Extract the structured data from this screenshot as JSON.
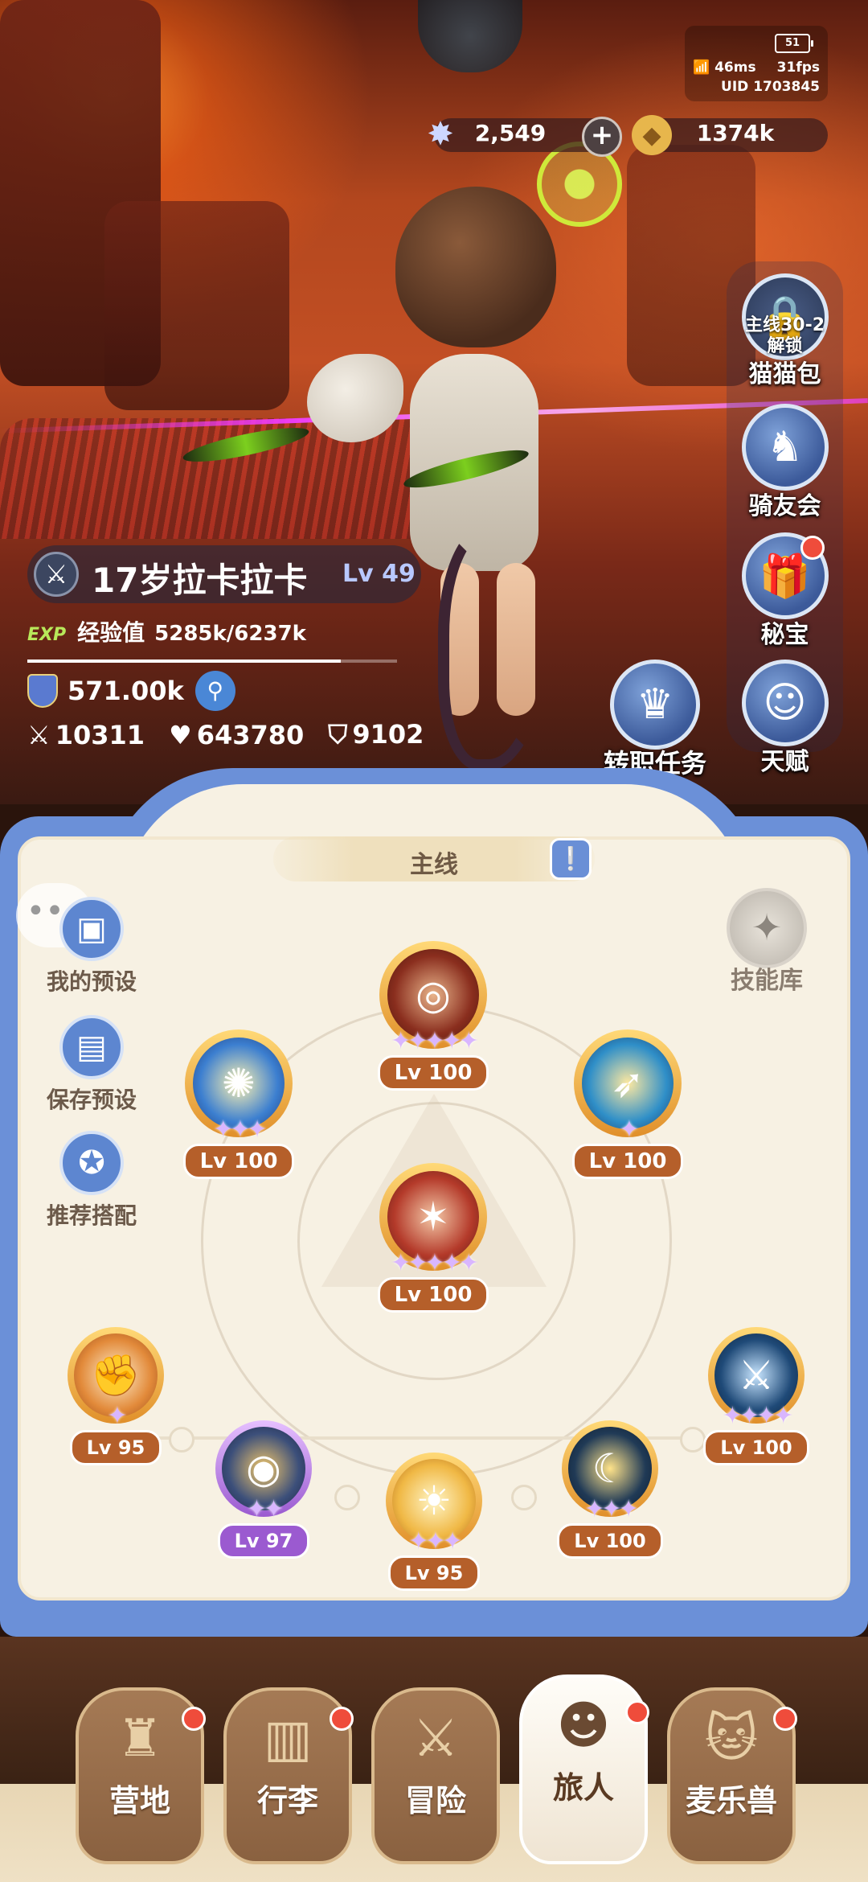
{
  "hud": {
    "battery": "51",
    "ping": "46ms",
    "fps": "31fps",
    "uid": "UID 1703845",
    "gems": "2,549",
    "gold": "1374k"
  },
  "right_menu": [
    {
      "label": "猫猫包",
      "lock_line1": "主线30-2",
      "lock_line2": "解锁",
      "icon": "lock-icon"
    },
    {
      "label": "骑友会",
      "icon": "horse-icon"
    },
    {
      "label": "秘宝",
      "icon": "treasure-chest-icon"
    },
    {
      "label": "天赋",
      "icon": "brain-icon"
    }
  ],
  "job_quest": {
    "label": "转职任务",
    "icon": "crown-icon"
  },
  "player": {
    "name": "17岁拉卡拉卡",
    "level": "Lv 49",
    "exp_badge": "EXP",
    "exp_label": "经验值",
    "exp_value": "5285k/6237k",
    "exp_progress": 0.847,
    "power": "571.00k",
    "attack": "10311",
    "hp": "643780",
    "defense": "9102"
  },
  "panel": {
    "tab": "主线",
    "left_buttons": [
      {
        "label": "我的预设",
        "icon": "preset-icon"
      },
      {
        "label": "保存预设",
        "icon": "save-icon"
      },
      {
        "label": "推荐搭配",
        "icon": "recommend-icon"
      }
    ],
    "skill_library": "技能库"
  },
  "skills": {
    "top": {
      "level": "Lv 100",
      "stars": "✦✦✦✦✦"
    },
    "upper_left": {
      "level": "Lv 100",
      "stars": "✦✦✦"
    },
    "upper_right": {
      "level": "Lv 100",
      "stars": "✦"
    },
    "center": {
      "level": "Lv 100",
      "stars": "✦✦✦✦✦"
    },
    "bottom1": {
      "level": "Lv 95",
      "stars": "✦"
    },
    "bottom2": {
      "level": "Lv 97",
      "stars": "✦✦"
    },
    "bottom3": {
      "level": "Lv 95",
      "stars": "✦✦✦"
    },
    "bottom4": {
      "level": "Lv 100",
      "stars": "✦✦✦"
    },
    "bottom5": {
      "level": "Lv 100",
      "stars": "✦✦✦✦"
    }
  },
  "nav": [
    {
      "label": "营地",
      "icon": "castle-icon"
    },
    {
      "label": "行李",
      "icon": "bag-icon"
    },
    {
      "label": "冒险",
      "icon": "crossed-swords-icon"
    },
    {
      "label": "旅人",
      "icon": "traveler-avatar-icon"
    },
    {
      "label": "麦乐兽",
      "icon": "cat-pet-icon"
    }
  ]
}
